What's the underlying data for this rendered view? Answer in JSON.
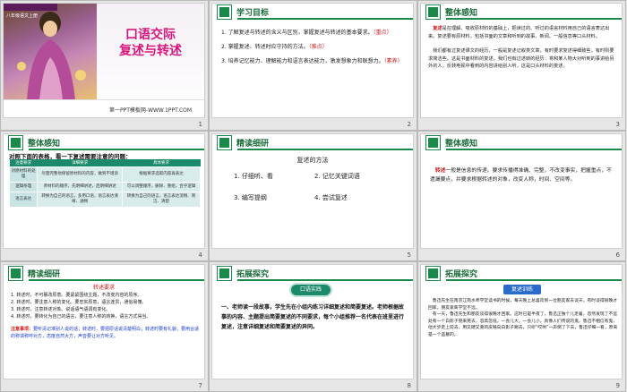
{
  "slides": [
    {
      "num": "1",
      "band": "八年级语文上册",
      "title_l1": "口语交际",
      "title_l2": "复述与转述",
      "footer": "第一PPT模板网-WWW.1PPT.COM"
    },
    {
      "num": "2",
      "header": "学习目标",
      "lines": [
        "1. 了解复述与转述的含义与区别，掌握复述与转述的基本要求。",
        "（重点）",
        "2. 掌握复述、转述时应守持的方法。",
        "（难点）",
        "3. 培养记忆能力、理解能力和语言表达能力，激发想象力和联想力。",
        "（素养）"
      ]
    },
    {
      "num": "3",
      "header": "整体感知",
      "term": "复述",
      "p1": "是在理解、吸收原材料的基础上，把读过的、听过的语言材料用自己的语言表达出来。复述要有原材料，包括书面的文章和听到的故事、新闻、一般信息等口头材料。",
      "p2": "我们都有过复述课文的经历，一般是复述记叙类文章，有时要求复述得细致些，有时则要求简洁些。这是书面材料的复述。我们也有过述转的经历：将和某人物大对听到的事讲给另外的人，反转电视中看到的内容讲给别人听，这是口头材料的复述。"
    },
    {
      "num": "4",
      "header": "整体感知",
      "intro": "对照下面的表格，看一下复述需要注意的问题：",
      "table": {
        "cols": [
          "注意要求",
          "详细要求",
          "具体要求"
        ],
        "rows": [
          [
            "对原材料的处理",
            "尽量完整地保留原材料的内容，做到不增添",
            "根据要求选取内容再表达"
          ],
          [
            "逻辑条理",
            "原材料的顺序，先明细讲述，后明细讲述",
            "可以调整顺序，删除、重组，合乎逻辑"
          ],
          [
            "语言表达",
            "转换为自己的语言，多用口语，语言表达清晰、通畅",
            "转换为自己的语言，语言表达流畅、简洁、清楚"
          ]
        ]
      }
    },
    {
      "num": "5",
      "header": "精读细研",
      "subtitle": "复述的方法",
      "methods": [
        "1. 仔细听、看",
        "2. 记忆关键词语",
        "3. 编写提纲",
        "4. 尝试复述"
      ]
    },
    {
      "num": "6",
      "header": "整体感知",
      "term": "转述",
      "p1": "一般是信息的传递。要求传播得准确、完整，不改变事实，把握重点，不遗漏要点，并要求根据转述的对象，改变人称，时间、空间等。"
    },
    {
      "num": "7",
      "header": "精读细研",
      "subtitle": "转述要求",
      "lines": [
        "1. 转述时，不可篡改原意。要紧紧围绕主题，不改变内容的原序。",
        "2. 转述时，要注意人称的变化。要忠实原意，语言连贯，通俗易懂。",
        "3. 转述时，注意转述对象。说话语气语调有变化。",
        "4. 转述时，要转化为自己的语言，要注意人称的转换，语言方式得当。"
      ],
      "note_label": "注意事项：",
      "note": "要听清记准别人说的话；转述时，要把原话说清楚明白；转述时要有礼貌，要用合适的称谓称呼对方，态度自然大方，声音要让对方听见。"
    },
    {
      "num": "8",
      "header": "拓展探究",
      "badge": "口语实践",
      "p1": "一、老师读一段故事，学生先在小组内练习详细复述和简要复述。老师根据故事的内容、主题提出简要复述的不同要求，每个小组推荐一名代表在班里进行复述，注意详细复述和简要复述的异同。"
    },
    {
      "num": "9",
      "header": "拓展探究",
      "badge": "复述训练",
      "p1": "鲁迅先生在南京江南水师学堂读书的时候，每天晚上总喜欢到一位朋友家去谈天，有时谈得很晚才回家。朋友家离学堂不远，",
      "p2": "有一天，鲁迅先生和朋友谈得很晚才回家。这时已是半夜了，鲁迅正独个儿走着，忽然发现了不远处有一个白影子晃来晃去，忽高忽低，一会儿大，一会儿小，真像人们传说的鬼，鲁迅不相信有鬼，他大步走上前去，用又硬又重的皮鞋向白影子踢去，只听“哎哟”一声倒了下去，鲁迅仔细一看，原来是一个盗墓的。"
    }
  ]
}
